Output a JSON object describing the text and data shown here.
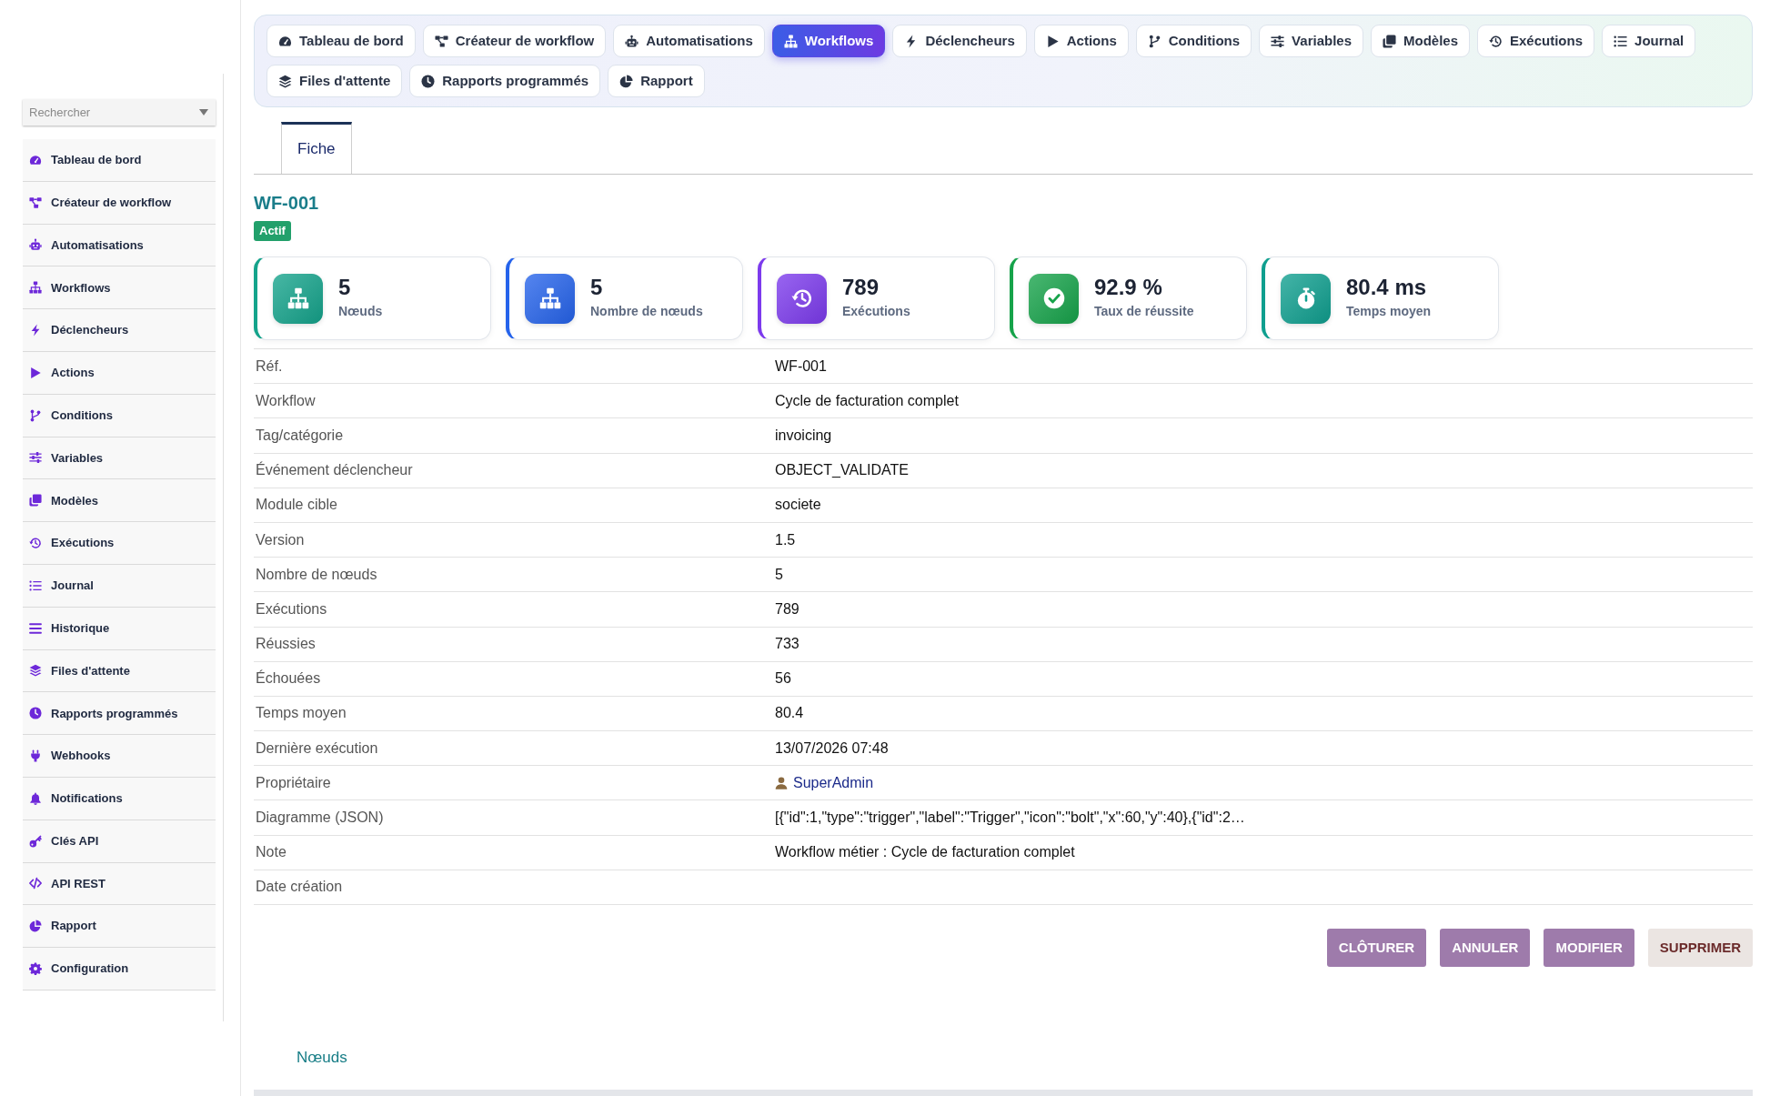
{
  "search": {
    "placeholder": "Rechercher"
  },
  "sidebar": {
    "items": [
      {
        "label": "Tableau de bord"
      },
      {
        "label": "Créateur de workflow"
      },
      {
        "label": "Automatisations"
      },
      {
        "label": "Workflows"
      },
      {
        "label": "Déclencheurs"
      },
      {
        "label": "Actions"
      },
      {
        "label": "Conditions"
      },
      {
        "label": "Variables"
      },
      {
        "label": "Modèles"
      },
      {
        "label": "Exécutions"
      },
      {
        "label": "Journal"
      },
      {
        "label": "Historique"
      },
      {
        "label": "Files d'attente"
      },
      {
        "label": "Rapports programmés"
      },
      {
        "label": "Webhooks"
      },
      {
        "label": "Notifications"
      },
      {
        "label": "Clés API"
      },
      {
        "label": "API REST"
      },
      {
        "label": "Rapport"
      },
      {
        "label": "Configuration"
      }
    ]
  },
  "top_nav": {
    "items": [
      {
        "label": "Tableau de bord",
        "selected": false
      },
      {
        "label": "Créateur de workflow",
        "selected": false
      },
      {
        "label": "Automatisations",
        "selected": false
      },
      {
        "label": "Workflows",
        "selected": true
      },
      {
        "label": "Déclencheurs",
        "selected": false
      },
      {
        "label": "Actions",
        "selected": false
      },
      {
        "label": "Conditions",
        "selected": false
      },
      {
        "label": "Variables",
        "selected": false
      },
      {
        "label": "Modèles",
        "selected": false
      },
      {
        "label": "Exécutions",
        "selected": false
      },
      {
        "label": "Journal",
        "selected": false
      },
      {
        "label": "Files d'attente",
        "selected": false
      },
      {
        "label": "Rapports programmés",
        "selected": false
      },
      {
        "label": "Rapport",
        "selected": false
      }
    ]
  },
  "tabs": [
    {
      "label": "Fiche",
      "selected": true
    }
  ],
  "record": {
    "title": "WF-001",
    "status": {
      "label": "Actif",
      "kind": "success"
    }
  },
  "stats": [
    {
      "value": "5",
      "label": "Nœuds",
      "color": "#14a38b"
    },
    {
      "value": "5",
      "label": "Nombre de nœuds",
      "color": "#2563eb"
    },
    {
      "value": "789",
      "label": "Exécutions",
      "color": "#7c3aed"
    },
    {
      "value": "92.9 %",
      "label": "Taux de réussite",
      "color": "#16a34a"
    },
    {
      "value": "80.4 ms",
      "label": "Temps moyen",
      "color": "#0f9f8f"
    }
  ],
  "fields": [
    {
      "label": "Réf.",
      "value": "WF-001",
      "kind": "text"
    },
    {
      "label": "Workflow",
      "value": "Cycle de facturation complet",
      "kind": "text"
    },
    {
      "label": "Tag/catégorie",
      "value": "invoicing",
      "kind": "text"
    },
    {
      "label": "Événement déclencheur",
      "value": "OBJECT_VALIDATE",
      "kind": "text"
    },
    {
      "label": "Module cible",
      "value": "societe",
      "kind": "text"
    },
    {
      "label": "Version",
      "value": "1.5",
      "kind": "text"
    },
    {
      "label": "Nombre de nœuds",
      "value": "5",
      "kind": "text"
    },
    {
      "label": "Exécutions",
      "value": "789",
      "kind": "text"
    },
    {
      "label": "Réussies",
      "value": "733",
      "kind": "text"
    },
    {
      "label": "Échouées",
      "value": "56",
      "kind": "text"
    },
    {
      "label": "Temps moyen",
      "value": "80.4",
      "kind": "text"
    },
    {
      "label": "Dernière exécution",
      "value": "13/07/2026 07:48",
      "kind": "text"
    },
    {
      "label": "Propriétaire",
      "value": "SuperAdmin",
      "kind": "user"
    },
    {
      "label": "Diagramme (JSON)",
      "value": "[{\"id\":1,\"type\":\"trigger\",\"label\":\"Trigger\",\"icon\":\"bolt\",\"x\":60,\"y\":40},{\"id\":2…",
      "kind": "text"
    },
    {
      "label": "Note",
      "value": "Workflow métier : Cycle de facturation complet",
      "kind": "text"
    },
    {
      "label": "Date création",
      "kind": "text"
    }
  ],
  "actions": [
    {
      "label": "CLÔTURER",
      "kind": "primary"
    },
    {
      "label": "ANNULER",
      "kind": "primary"
    },
    {
      "label": "MODIFIER",
      "kind": "primary"
    },
    {
      "label": "SUPPRIMER",
      "kind": "danger"
    }
  ],
  "nodes_section": {
    "title": "Nœuds"
  }
}
